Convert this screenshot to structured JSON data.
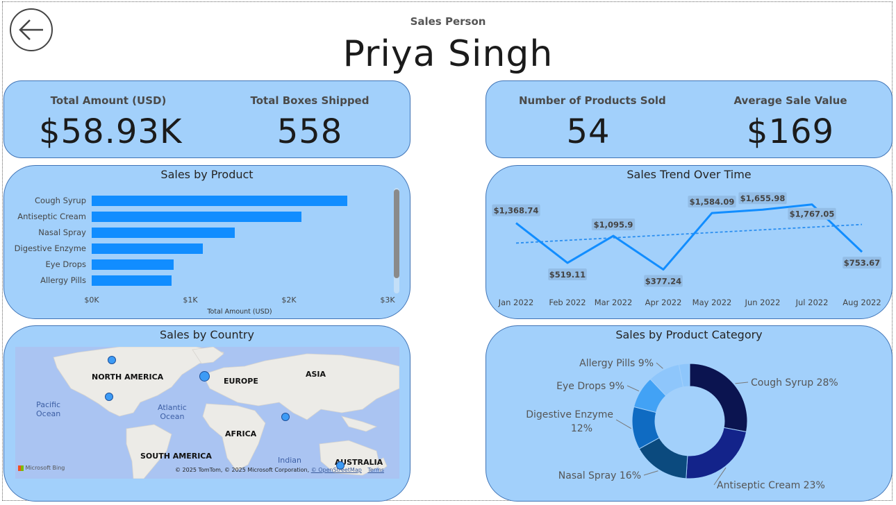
{
  "header": {
    "back_icon": "arrow-left-icon",
    "label": "Sales Person",
    "name": "Priya Singh"
  },
  "kpis_left": [
    {
      "label": "Total Amount (USD)",
      "value": "$58.93K"
    },
    {
      "label": "Total Boxes Shipped",
      "value": "558"
    }
  ],
  "kpis_right": [
    {
      "label": "Number of Products Sold",
      "value": "54"
    },
    {
      "label": "Average Sale Value",
      "value": "$169"
    }
  ],
  "colors": {
    "card_bg": "#a2d0fb",
    "card_border": "#3f73b5",
    "bar": "#118dff",
    "line": "#118dff",
    "donut": [
      "#0b1450",
      "#13238a",
      "#0b4a7e",
      "#0f6bc2",
      "#42a2f5",
      "#8ec6fb"
    ]
  },
  "charts": {
    "product": {
      "title": "Sales by Product",
      "axis_title": "Total Amount (USD)",
      "ticks": [
        "$0K",
        "$1K",
        "$2K",
        "$3K"
      ]
    },
    "trend": {
      "title": "Sales Trend Over Time"
    },
    "country": {
      "title": "Sales by Country",
      "continents": [
        "NORTH AMERICA",
        "EUROPE",
        "ASIA",
        "AFRICA",
        "SOUTH AMERICA",
        "AUSTRALIA"
      ],
      "oceans": [
        "Pacific\nOcean",
        "Atlantic\nOcean",
        "Indian"
      ],
      "credit": "© 2025 TomTom, © 2025 Microsoft Corporation,",
      "credit_link": "© OpenStreetMap",
      "terms": "Terms",
      "logo": "Microsoft Bing"
    },
    "category": {
      "title": "Sales by Product Category"
    }
  },
  "chart_data": [
    {
      "type": "bar",
      "title": "Sales by Product",
      "xlabel": "Total Amount (USD)",
      "ylabel": "",
      "orientation": "horizontal",
      "categories": [
        "Cough Syrup",
        "Antiseptic Cream",
        "Nasal Spray",
        "Digestive Enzyme",
        "Eye Drops",
        "Allergy Pills"
      ],
      "values": [
        2590,
        2130,
        1450,
        1130,
        830,
        810
      ],
      "xlim": [
        0,
        3000
      ],
      "grid": false
    },
    {
      "type": "line",
      "title": "Sales Trend Over Time",
      "x": [
        "Jan 2022",
        "Feb 2022",
        "Mar 2022",
        "Apr 2022",
        "May 2022",
        "Jun 2022",
        "Jul 2022",
        "Aug 2022"
      ],
      "values": [
        1368.74,
        519.11,
        1095.9,
        377.24,
        1584.09,
        1655.98,
        1767.05,
        753.67
      ],
      "data_labels": [
        "$1,368.74",
        "$519.11",
        "$1,095.9",
        "$377.24",
        "$1,584.09",
        "$1,655.98",
        "$1,767.05",
        "$753.67"
      ],
      "trendline": true,
      "ylim": [
        0,
        2000
      ]
    },
    {
      "type": "scatter",
      "title": "Sales by Country",
      "subtype": "map-bubbles",
      "points": [
        {
          "region": "Canada",
          "lon": -100,
          "lat": 57
        },
        {
          "region": "United States",
          "lon": -98,
          "lat": 39
        },
        {
          "region": "United Kingdom",
          "lon": -2,
          "lat": 54
        },
        {
          "region": "India",
          "lon": 79,
          "lat": 21
        },
        {
          "region": "Australia",
          "lon": 147,
          "lat": -31
        }
      ]
    },
    {
      "type": "pie",
      "title": "Sales by Product Category",
      "donut": true,
      "slices": [
        {
          "label": "Cough Syrup",
          "percent": 28,
          "text": "Cough Syrup 28%"
        },
        {
          "label": "Antiseptic Cream",
          "percent": 23,
          "text": "Antiseptic Cream 23%"
        },
        {
          "label": "Nasal Spray",
          "percent": 16,
          "text": "Nasal Spray 16%"
        },
        {
          "label": "Digestive Enzyme",
          "percent": 12,
          "text": "Digestive Enzyme 12%"
        },
        {
          "label": "Eye Drops",
          "percent": 9,
          "text": "Eye Drops 9%"
        },
        {
          "label": "Allergy Pills",
          "percent": 9,
          "text": "Allergy Pills 9%"
        },
        {
          "label": "",
          "percent": 3,
          "text": ""
        }
      ]
    }
  ]
}
